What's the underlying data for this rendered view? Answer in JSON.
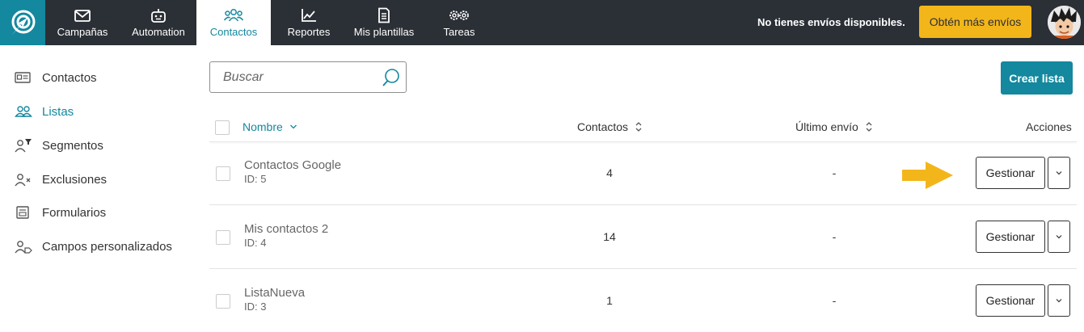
{
  "topbar": {
    "nav": [
      {
        "label": "Campañas",
        "icon": "mail-icon"
      },
      {
        "label": "Automation",
        "icon": "robot-icon"
      },
      {
        "label": "Contactos",
        "icon": "contacts-icon"
      },
      {
        "label": "Reportes",
        "icon": "chart-icon"
      },
      {
        "label": "Mis plantillas",
        "icon": "document-icon"
      },
      {
        "label": "Tareas",
        "icon": "gears-icon"
      }
    ],
    "active_nav": "Contactos",
    "no_envios": "No tienes envíos disponibles.",
    "more_button": "Obtén más envíos",
    "accent_color": "#13889e",
    "more_button_color": "#f3b61a",
    "bar_color": "#2b2f36"
  },
  "sidebar": {
    "items": [
      {
        "label": "Contactos",
        "icon": "id-card-icon"
      },
      {
        "label": "Listas",
        "icon": "people-icon"
      },
      {
        "label": "Segmentos",
        "icon": "user-filter-icon"
      },
      {
        "label": "Exclusiones",
        "icon": "user-x-icon"
      },
      {
        "label": "Formularios",
        "icon": "form-icon"
      },
      {
        "label": "Campos personalizados",
        "icon": "user-tag-icon"
      }
    ],
    "active": "Listas"
  },
  "toolbar": {
    "search_placeholder": "Buscar",
    "create_label": "Crear lista"
  },
  "table": {
    "headers": {
      "name": "Nombre",
      "contacts": "Contactos",
      "last": "Último envío",
      "actions": "Acciones"
    },
    "rows": [
      {
        "name": "Contactos Google",
        "id": "ID: 5",
        "contacts": "4",
        "last": "-",
        "action": "Gestionar"
      },
      {
        "name": "Mis contactos 2",
        "id": "ID: 4",
        "contacts": "14",
        "last": "-",
        "action": "Gestionar"
      },
      {
        "name": "ListaNueva",
        "id": "ID: 3",
        "contacts": "1",
        "last": "-",
        "action": "Gestionar"
      }
    ]
  },
  "annotation": {
    "arrow_color": "#f3b61a"
  }
}
